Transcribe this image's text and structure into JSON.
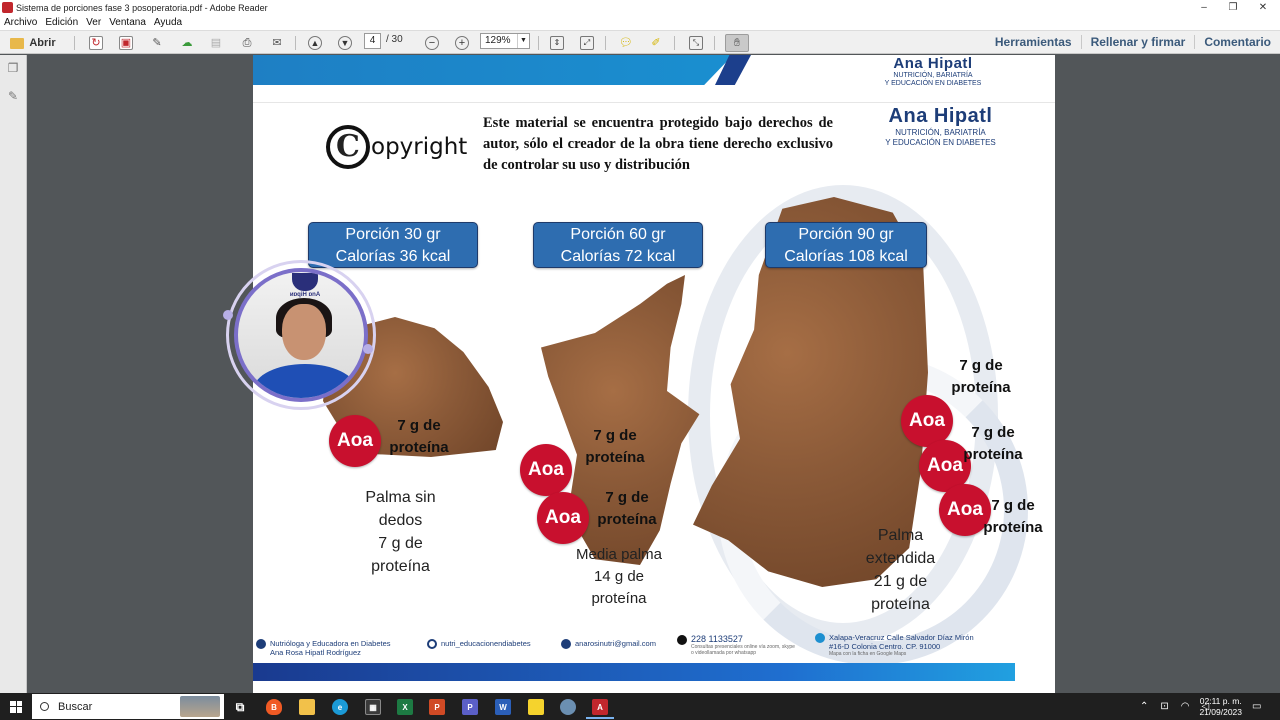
{
  "window": {
    "title": "Sistema de porciones fase 3 posoperatoria.pdf - Adobe Reader",
    "controls": [
      "–",
      "❐",
      "✕"
    ]
  },
  "menu": [
    "Archivo",
    "Edición",
    "Ver",
    "Ventana",
    "Ayuda"
  ],
  "toolbar": {
    "open_label": "Abrir",
    "page_current": "4",
    "page_total": "/ 30",
    "zoom": "129%",
    "right_links": [
      "Herramientas",
      "Rellenar y firmar",
      "Comentario"
    ]
  },
  "document": {
    "brand": {
      "name": "Ana Hipatl",
      "sub_line1": "NUTRICIÓN, BARIATRÍA",
      "sub_line2": "Y EDUCACIÓN EN DIABETES"
    },
    "copyright_symbol": "C",
    "copyright_word": "opyright",
    "notice": "Este material se encuentra protegido bajo derechos de autor, sólo el creador de la obra tiene derecho exclusivo de controlar su uso y distribución",
    "portions": [
      {
        "line1": "Porción 30 gr",
        "line2": "Calorías 36 kcal"
      },
      {
        "line1": "Porción 60 gr",
        "line2": "Calorías 72 kcal"
      },
      {
        "line1": "Porción 90 gr",
        "line2": "Calorías 108 kcal"
      }
    ],
    "badge_label": "Aoa",
    "protein_line1": "7 g de",
    "protein_line2": "proteína",
    "captions": [
      [
        "Palma sin",
        "dedos",
        "7 g de",
        "proteína"
      ],
      [
        "Media palma",
        "14 g de",
        "proteína"
      ],
      [
        "Palma",
        "extendida",
        "21 g de",
        "proteína"
      ]
    ],
    "avatar_badge": "ᴎɒqiH ɒnA",
    "footer": {
      "facebook_line1": "Nutrióloga y Educadora en Diabetes",
      "facebook_line2": "Ana Rosa Hipatl Rodríguez",
      "instagram": "nutri_educacionendiabetes",
      "email": "anarosinutri@gmail.com",
      "phone": "228 1133527",
      "phone_note1": "Consultas presenciales online vía zoom, skype",
      "phone_note2": "o videollamada por whatsapp",
      "address_line1": "Xalapa-Veracruz Calle Salvador Díaz Mirón",
      "address_line2": "#16-D Colonia Centro. CP. 91000",
      "address_note": "Mapa con la ficha en Google Maps"
    }
  },
  "taskbar": {
    "search_label": "Buscar",
    "time": "02:11 p. m.",
    "date": "21/09/2023"
  },
  "colors": {
    "accent_blue": "#2e6db0",
    "badge_red": "#c8102e",
    "brand_navy": "#1d3d78"
  }
}
